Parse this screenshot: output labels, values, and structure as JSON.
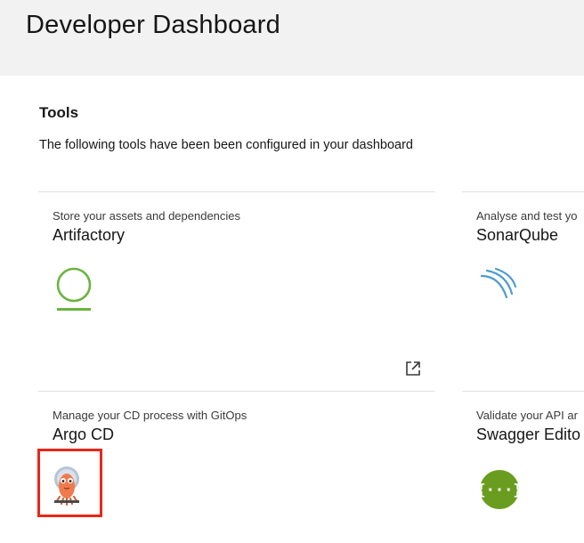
{
  "header": {
    "title": "Developer Dashboard"
  },
  "tools_section": {
    "title": "Tools",
    "description": "The following tools have been been configured in your dashboard"
  },
  "tiles": [
    {
      "description": "Store your assets and dependencies",
      "name": "Artifactory",
      "icon": "artifactory-logo",
      "color": "#6ab43e"
    },
    {
      "description": "Analyse and test yo",
      "name": "SonarQube",
      "icon": "sonarqube-logo",
      "color": "#4e9bcd"
    },
    {
      "description": "Manage your CD process with GitOps",
      "name": "Argo CD",
      "icon": "argo-cd-logo",
      "color": "#ef7b4d"
    },
    {
      "description": "Validate your API ar",
      "name": "Swagger Edito",
      "icon": "swagger-logo",
      "color": "#6a9d1f"
    }
  ],
  "colors": {
    "header_bg": "#f2f2f2",
    "divider": "#e0e0e0",
    "highlight": "#e8261b"
  }
}
